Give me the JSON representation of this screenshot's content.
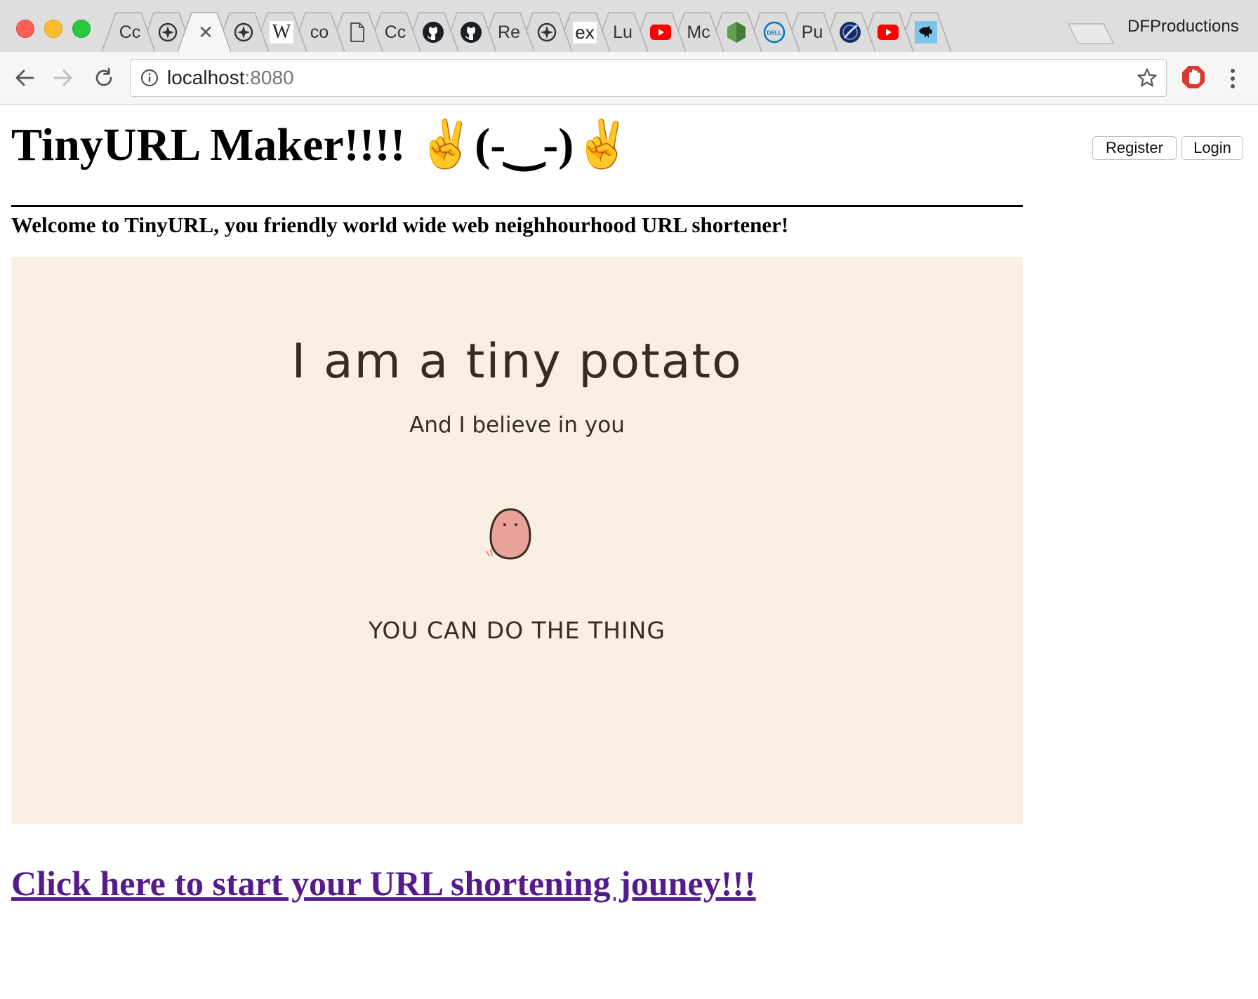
{
  "browser": {
    "tabs": [
      {
        "kind": "text",
        "label": "Cc",
        "icon": "text"
      },
      {
        "kind": "icon",
        "label": "",
        "icon": "compass-icon"
      },
      {
        "kind": "active",
        "label": "",
        "icon": "close-icon"
      },
      {
        "kind": "icon",
        "label": "",
        "icon": "compass-icon"
      },
      {
        "kind": "wiki",
        "label": "W",
        "icon": "wikipedia"
      },
      {
        "kind": "text",
        "label": "co",
        "icon": "text"
      },
      {
        "kind": "icon",
        "label": "",
        "icon": "document-icon"
      },
      {
        "kind": "text",
        "label": "Cc",
        "icon": "text"
      },
      {
        "kind": "icon",
        "label": "",
        "icon": "github-icon"
      },
      {
        "kind": "icon",
        "label": "",
        "icon": "github-icon"
      },
      {
        "kind": "text",
        "label": "Re",
        "icon": "text"
      },
      {
        "kind": "icon",
        "label": "",
        "icon": "compass-icon"
      },
      {
        "kind": "ex",
        "label": "ex",
        "icon": "ex"
      },
      {
        "kind": "text",
        "label": "Lu",
        "icon": "text"
      },
      {
        "kind": "icon",
        "label": "",
        "icon": "youtube-icon"
      },
      {
        "kind": "text",
        "label": "Mc",
        "icon": "text"
      },
      {
        "kind": "icon",
        "label": "",
        "icon": "hexagon-icon"
      },
      {
        "kind": "icon",
        "label": "",
        "icon": "dell-icon"
      },
      {
        "kind": "text",
        "label": "Pu",
        "icon": "text"
      },
      {
        "kind": "icon",
        "label": "",
        "icon": "globe-icon"
      },
      {
        "kind": "icon",
        "label": "",
        "icon": "youtube-icon"
      },
      {
        "kind": "icon",
        "label": "",
        "icon": "bird-icon"
      }
    ],
    "dell_text": "DELL",
    "profile_name": "DFProductions",
    "url_host": "localhost",
    "url_port": ":8080"
  },
  "header": {
    "title": "TinyURL Maker!!!! ✌️(-‿-)✌️",
    "register_label": "Register",
    "login_label": "Login"
  },
  "main": {
    "welcome": "Welcome to TinyURL, you friendly world wide web neighhourhood URL shortener!",
    "hero": {
      "title": "I am a tiny potato",
      "subtitle": "And I believe in you",
      "footer": "YOU CAN DO THE THING",
      "background": "#faefe5"
    },
    "cta_link": "Click here to start your URL shortening jouney!!!"
  },
  "colors": {
    "link_visited": "#551a8b",
    "hero_bg": "#faefe5",
    "hero_text": "#3a2a20"
  }
}
